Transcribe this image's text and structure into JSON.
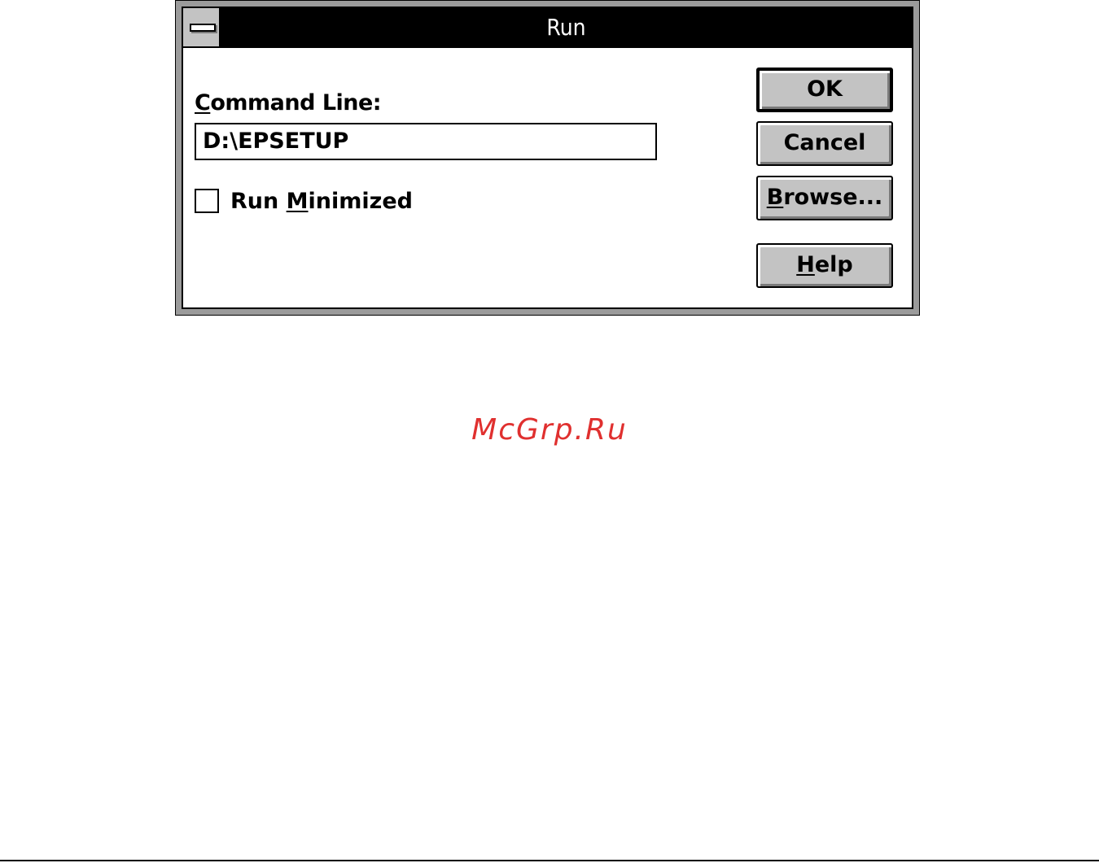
{
  "window": {
    "title": "Run"
  },
  "command_line": {
    "label_prefix": "C",
    "label_rest": "ommand Line:",
    "value": "D:\\EPSETUP"
  },
  "run_minimized": {
    "label_prefix": "Run ",
    "label_mnemonic": "M",
    "label_rest": "inimized",
    "checked": false
  },
  "buttons": {
    "ok": "OK",
    "cancel": "Cancel",
    "browse_mnemonic": "B",
    "browse_rest": "rowse...",
    "help_mnemonic": "H",
    "help_rest": "elp"
  },
  "watermark": "McGrp.Ru",
  "colors": {
    "button_face": "#c3c3c3",
    "titlebar": "#000000",
    "watermark": "#e0302f"
  }
}
